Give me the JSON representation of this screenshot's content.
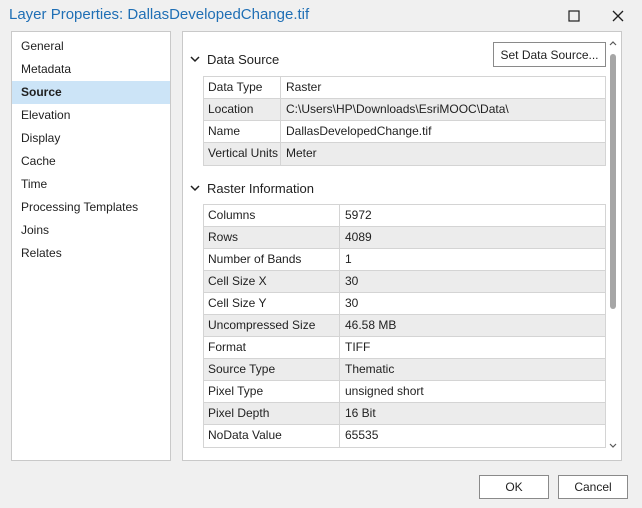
{
  "window": {
    "title": "Layer Properties: DallasDevelopedChange.tif",
    "title_color": "#1f6fb5"
  },
  "nav": {
    "items": [
      {
        "label": "General"
      },
      {
        "label": "Metadata"
      },
      {
        "label": "Source",
        "selected": true
      },
      {
        "label": "Elevation"
      },
      {
        "label": "Display"
      },
      {
        "label": "Cache"
      },
      {
        "label": "Time"
      },
      {
        "label": "Processing Templates"
      },
      {
        "label": "Joins"
      },
      {
        "label": "Relates"
      }
    ],
    "selected_color": "#cce4f7"
  },
  "data_source": {
    "title": "Data Source",
    "button": "Set Data Source...",
    "rows": [
      {
        "key": "Data Type",
        "value": "Raster"
      },
      {
        "key": "Location",
        "value": "C:\\Users\\HP\\Downloads\\EsriMOOC\\Data\\"
      },
      {
        "key": "Name",
        "value": "DallasDevelopedChange.tif"
      },
      {
        "key": "Vertical Units",
        "value": "Meter"
      }
    ]
  },
  "raster_info": {
    "title": "Raster Information",
    "rows": [
      {
        "key": "Columns",
        "value": "5972"
      },
      {
        "key": "Rows",
        "value": "4089"
      },
      {
        "key": "Number of Bands",
        "value": "1"
      },
      {
        "key": "Cell Size X",
        "value": "30"
      },
      {
        "key": "Cell Size Y",
        "value": "30"
      },
      {
        "key": "Uncompressed Size",
        "value": "46.58 MB"
      },
      {
        "key": "Format",
        "value": "TIFF"
      },
      {
        "key": "Source Type",
        "value": "Thematic"
      },
      {
        "key": "Pixel Type",
        "value": "unsigned short"
      },
      {
        "key": "Pixel Depth",
        "value": "16 Bit"
      },
      {
        "key": "NoData Value",
        "value": "65535"
      }
    ]
  },
  "footer": {
    "ok": "OK",
    "cancel": "Cancel"
  }
}
